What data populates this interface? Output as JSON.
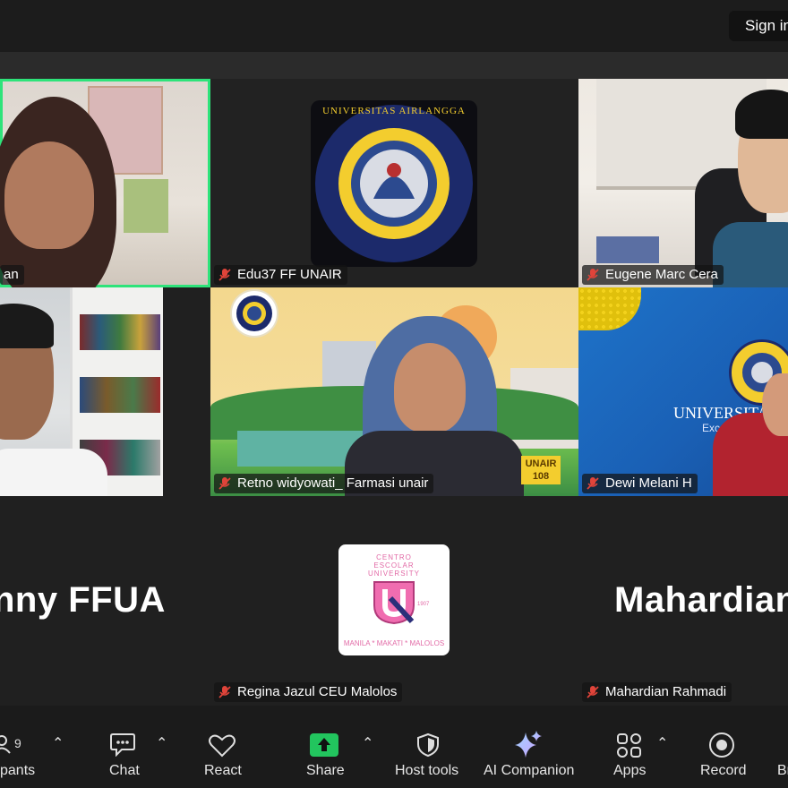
{
  "topbar": {
    "sign_in": "Sign in"
  },
  "tiles": [
    {
      "name": "an",
      "muted": false,
      "active": true
    },
    {
      "name": "Edu37 FF UNAIR",
      "muted": true
    },
    {
      "name": "Eugene Marc Cera",
      "muted": true
    },
    {
      "name": "",
      "muted": false
    },
    {
      "name": "Retno widyowati_ Farmasi unair",
      "muted": true
    },
    {
      "name": "Dewi Melani H",
      "muted": true
    },
    {
      "name": "Regina Jazul CEU Malolos",
      "muted": true
    },
    {
      "name": "Mahardian Rahmadi",
      "muted": true
    }
  ],
  "avatar_names": {
    "left": "nny FFUA",
    "right": "Mahardian"
  },
  "logos": {
    "unair_ring_text": "UNIVERSITAS AIRLANGGA",
    "unair_bottom": "UNAIR",
    "ceu_top": "CENTRO ESCOLAR UNIVERSITY",
    "ceu_bottom": "MANILA * MAKATI * MALOLOS",
    "ceu_year": "1907",
    "dewi_bg_title": "UNIVERSITAS AI",
    "dewi_bg_sub": "Excellence wi",
    "retno_badge": "UNAIR 108"
  },
  "toolbar": {
    "participants_label": "pants",
    "participants_count": "9",
    "chat": "Chat",
    "react": "React",
    "share": "Share",
    "host_tools": "Host tools",
    "ai_companion": "AI Companion",
    "apps": "Apps",
    "record": "Record",
    "more": "Br"
  },
  "colors": {
    "active_border": "#2ee37a",
    "share_green": "#22c55e",
    "muted_red": "#e0443a",
    "unair_navy": "#1c2a6b",
    "unair_yellow": "#f3cd2e"
  }
}
